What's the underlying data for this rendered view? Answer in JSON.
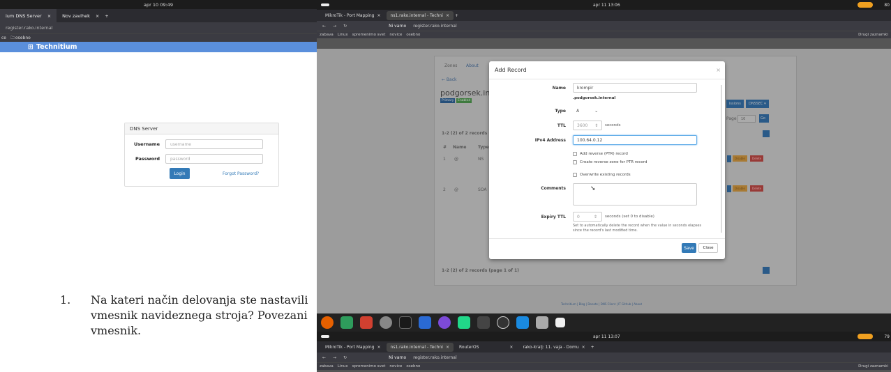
{
  "left": {
    "clock": "apr 10 09:49",
    "tabs": [
      {
        "label": "ium DNS Server",
        "close": "×"
      },
      {
        "label": "Nov zavihek",
        "close": "×"
      }
    ],
    "new_tab": "+",
    "url": "register.rako.internal",
    "bookmarks": [
      "ce",
      "osebno"
    ],
    "app_title": "Technitium",
    "login": {
      "title": "DNS Server",
      "username_label": "Username",
      "username_placeholder": "username",
      "password_label": "Password",
      "password_placeholder": "password",
      "login_button": "Login",
      "forgot_link": "Forgot Password?"
    },
    "question": {
      "number": "1.",
      "text": "Na kateri način delovanja ste nastavili vmesnik navideznega stroja? Povezani vmesnik."
    }
  },
  "right": {
    "top_screen": {
      "clock": "apr 11 13:06",
      "battery": "80",
      "tabs": [
        {
          "label": "MikroTik - Port Mapping",
          "close": "×"
        },
        {
          "label": "ns1.rako.internal - Techni",
          "close": "×"
        }
      ],
      "new_tab": "+",
      "url_secure": "Ni varno",
      "url": "register.rako.internal",
      "bookmarks": [
        "zabava",
        "Linux",
        "spremenimo svet",
        "novice",
        "osebno"
      ],
      "other_bookmarks": "Drugi zaznamki"
    },
    "background_page": {
      "tabs": [
        "Zones",
        "About"
      ],
      "back": "← Back",
      "zone_name": "podgorsek.inter",
      "badges": [
        "Primary",
        "Enabled"
      ],
      "records_count_top": "1-2 (2) of 2 records (pag",
      "records_count_bottom": "1-2 (2) of 2 records (page 1 of 1)",
      "columns": [
        "#",
        "Name",
        "Type"
      ],
      "rows": [
        {
          "num": "1",
          "name": "@",
          "type": "NS"
        },
        {
          "num": "2",
          "name": "@",
          "type": "SOA"
        }
      ],
      "right_buttons": [
        "issions",
        "DNSSEC ▾"
      ],
      "per_page_label": "Page",
      "per_page_value": "10",
      "go_button": "Go",
      "row_action_disable": "Disable",
      "row_action_delete": "Delete",
      "footer": "Technitium | Blog | Donate | DNS Client | IT Github | About"
    },
    "modal": {
      "title": "Add Record",
      "close": "×",
      "name_label": "Name",
      "name_value": "krompir",
      "zone_suffix": ".podgorsek.internal",
      "type_label": "Type",
      "type_value": "A",
      "ttl_label": "TTL",
      "ttl_value": "3600",
      "ttl_unit": "seconds",
      "ipv4_label": "IPv4 Address",
      "ipv4_value": "100.64.0.12",
      "check_ptr": "Add reverse (PTR) record",
      "check_reverse_zone": "Create reverse zone for PTR record",
      "check_overwrite": "Overwrite existing records",
      "comments_label": "Comments",
      "expiry_label": "Expiry TTL",
      "expiry_value": "0",
      "expiry_unit": "seconds (set 0 to disable)",
      "expiry_help": "Set to automatically delete the record when the value in seconds elapses since the record's last modified time.",
      "save_button": "Save",
      "close_button": "Close"
    },
    "bottom_screen": {
      "clock": "apr 11 13:07",
      "battery": "79",
      "tabs": [
        {
          "label": "MikroTik - Port Mapping",
          "close": "×"
        },
        {
          "label": "ns1.rako.internal - Techni",
          "close": "×"
        },
        {
          "label": "RouterOS",
          "close": "×"
        },
        {
          "label": "rako-kralj: 11. vaja - Domu",
          "close": "×"
        }
      ],
      "new_tab": "+",
      "url_secure": "Ni varno",
      "url": "register.rako.internal",
      "bookmarks": [
        "zabava",
        "Linux",
        "spremenimo svet",
        "novice",
        "osebno"
      ],
      "other_bookmarks": "Drugi zaznamki"
    },
    "colors": {
      "primary": "#337ab7",
      "success": "#5cb85c",
      "warning": "#f0ad4e",
      "danger": "#d9534f",
      "technitium": "#5a8fdc"
    }
  }
}
